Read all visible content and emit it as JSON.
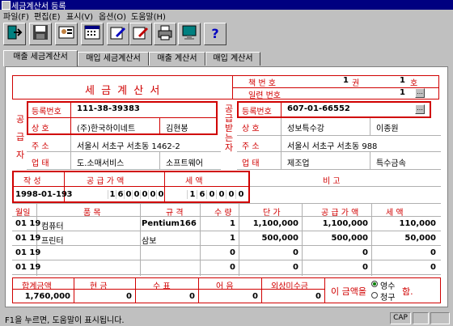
{
  "window": {
    "title": "세금계산서 등록"
  },
  "menu": [
    {
      "label": "파일(F)"
    },
    {
      "label": "편집(E)"
    },
    {
      "label": "표시(V)"
    },
    {
      "label": "옵션(O)"
    },
    {
      "label": "도움말(H)"
    }
  ],
  "toolbar": {
    "help_label": "?"
  },
  "tabs": [
    {
      "label": "매출 세금계산서"
    },
    {
      "label": "매입 세금계산서"
    },
    {
      "label": "매출 계산서"
    },
    {
      "label": "매입 계산서"
    }
  ],
  "invoice": {
    "title": "세 금 계 산 서",
    "book_no_label": "책 번 호",
    "book_no": "1",
    "book_unit": "권",
    "book_page": "1",
    "book_page_unit": "호",
    "serial_label": "일련 번호",
    "serial": "1",
    "supplier": {
      "side_label": "공 급 자",
      "reg_label": "등록번호",
      "reg_no": "111-38-39383",
      "name_label": "상    호",
      "name": "(주)한국하이네트",
      "rep": "김현봉",
      "addr_label": "주    소",
      "addr": "서울시 서초구 서초동 1462-2",
      "type_label": "업    태",
      "type": "도.소매서비스",
      "item": "소프트웨어"
    },
    "buyer": {
      "side_label": "공 급 받 는 자",
      "reg_label": "등록번호",
      "reg_no": "607-01-66552",
      "name_label": "상    호",
      "name": "성보특수강",
      "rep": "이종원",
      "addr_label": "주    소",
      "addr": "서울시 서초구 서초동 988",
      "type_label": "업    태",
      "type": "제조업",
      "item": "특수금속"
    },
    "summary": {
      "date_label": "작 성",
      "supply_label": "공 급 가 액",
      "tax_label": "세    액",
      "note_label": "비    고",
      "date": "1998-01-19",
      "blank_count": "3",
      "supply_digits": [
        "",
        "",
        "",
        "",
        "1",
        "6",
        "0",
        "0",
        "0",
        "0",
        "0"
      ],
      "tax_digits": [
        "",
        "",
        "1",
        "6",
        "0",
        "0",
        "0",
        "0"
      ]
    },
    "items_header": {
      "month": "월일",
      "name": "품      목",
      "spec": "규 격",
      "qty": "수 량",
      "price": "단 가",
      "supply": "공 급 가 액",
      "tax": "세 액"
    },
    "items": [
      {
        "md": "01 19",
        "name": "컴퓨터",
        "spec": "Pentium166",
        "qty": "1",
        "price": "1,100,000",
        "supply": "1,100,000",
        "tax": "110,000"
      },
      {
        "md": "01 19",
        "name": "프린터",
        "spec": "삼보",
        "qty": "1",
        "price": "500,000",
        "supply": "500,000",
        "tax": "50,000"
      },
      {
        "md": "01 19",
        "name": "",
        "spec": "",
        "qty": "0",
        "price": "0",
        "supply": "0",
        "tax": "0"
      },
      {
        "md": "01 19",
        "name": "",
        "spec": "",
        "qty": "0",
        "price": "0",
        "supply": "0",
        "tax": "0"
      }
    ],
    "totals": {
      "total_label": "합계금액",
      "cash_label": "현    금",
      "check_label": "수    표",
      "note_label": "어    음",
      "credit_label": "외상미수금",
      "total": "1,760,000",
      "cash": "0",
      "check": "0",
      "note": "0",
      "credit": "0",
      "amount_prefix": "이 금액을",
      "opt_receipt": "영수",
      "opt_claim": "청구",
      "suffix": "함."
    }
  },
  "status": {
    "text": "F1을 누르면, 도움말이 표시됩니다.",
    "cap": "CAP"
  }
}
